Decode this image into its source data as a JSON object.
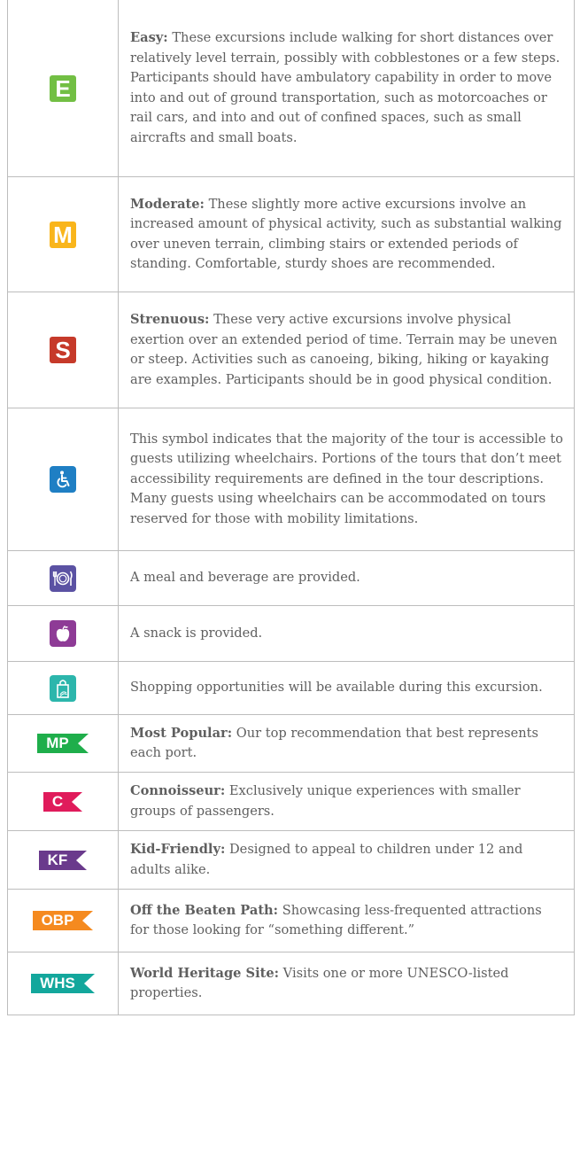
{
  "rows": [
    {
      "icon": {
        "name": "easy-badge",
        "text": "E",
        "color": "#72bf44"
      },
      "term": "Easy:",
      "description": "These excursions include walking for short distances over relatively level terrain, possibly with cobblestones or a few steps. Participants should have ambulatory capability in order to move into and out of ground transportation, such as motorcoaches or rail cars, and into and out of confined spaces, such as small aircrafts and small boats."
    },
    {
      "icon": {
        "name": "moderate-badge",
        "text": "M",
        "color": "#f9b51b"
      },
      "term": "Moderate:",
      "description": "These slightly more active excursions involve an increased amount of physical activity, such as substantial walking over uneven terrain, climbing stairs or extended periods of standing. Comfortable, sturdy shoes are recommended."
    },
    {
      "icon": {
        "name": "strenuous-badge",
        "text": "S",
        "color": "#c63a2a"
      },
      "term": "Strenuous:",
      "description": "These very active excursions involve physical exertion over an extended period of time. Terrain may be uneven or steep. Activities such as canoeing, biking, hiking or kayaking are examples. Participants should be in good physical condition."
    },
    {
      "icon": {
        "name": "wheelchair-icon",
        "color": "#1f7fc4"
      },
      "term": "",
      "description": "This symbol indicates that the majority of the tour is accessible to guests utilizing wheelchairs. Portions of the tours that don’t meet accessibility requirements are defined in the tour descriptions. Many guests using wheelchairs can be accommodated on tours reserved for those with mobility limitations."
    },
    {
      "icon": {
        "name": "meal-icon",
        "color": "#5b52a3"
      },
      "term": "",
      "description": "A meal and beverage are provided."
    },
    {
      "icon": {
        "name": "snack-apple-icon",
        "color": "#8e3b96"
      },
      "term": "",
      "description": "A snack is provided."
    },
    {
      "icon": {
        "name": "shopping-bag-icon",
        "color": "#2cb6ac"
      },
      "term": "",
      "description": "Shopping opportunities will be available during this excursion."
    },
    {
      "icon": {
        "name": "most-popular-flag",
        "text": "MP",
        "color": "#1fae4b"
      },
      "term": "Most Popular:",
      "description": "Our top recommendation that best represents each port."
    },
    {
      "icon": {
        "name": "connoisseur-flag",
        "text": "C",
        "color": "#e01b5b"
      },
      "term": "Connoisseur:",
      "description": "Exclusively unique experiences with smaller groups of passengers."
    },
    {
      "icon": {
        "name": "kid-friendly-flag",
        "text": "KF",
        "color": "#6a3a8c"
      },
      "term": "Kid-Friendly:",
      "description": "Designed to appeal to children under 12 and adults alike."
    },
    {
      "icon": {
        "name": "off-the-beaten-path-flag",
        "text": "OBP",
        "color": "#f58a1f"
      },
      "term": "Off the Beaten Path:",
      "description": "Showcasing less-frequented attractions for those looking for “something different.”"
    },
    {
      "icon": {
        "name": "world-heritage-site-flag",
        "text": "WHS",
        "color": "#13a79c"
      },
      "term": "World Heritage Site:",
      "description": "Visits one or more UNESCO-listed properties."
    }
  ]
}
